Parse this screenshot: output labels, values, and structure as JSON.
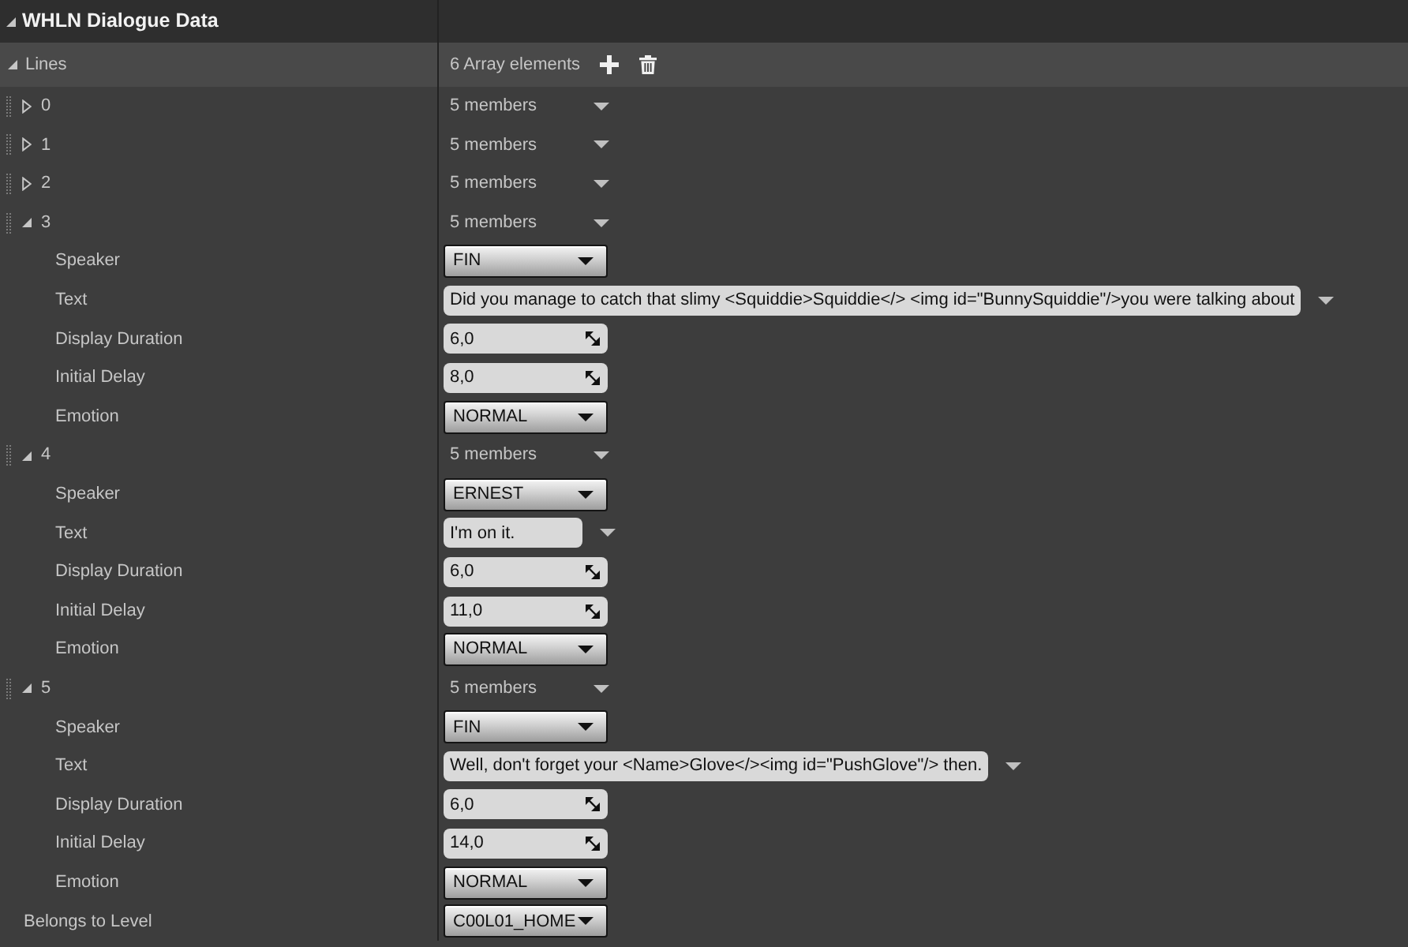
{
  "panel": {
    "title": "WHLN Dialogue Data",
    "expanded": true
  },
  "lines": {
    "label": "Lines",
    "expanded": true,
    "count": "6 Array elements",
    "elements": [
      {
        "index": "0",
        "expanded": false,
        "summary": "5 members"
      },
      {
        "index": "1",
        "expanded": false,
        "summary": "5 members"
      },
      {
        "index": "2",
        "expanded": false,
        "summary": "5 members"
      },
      {
        "index": "3",
        "expanded": true,
        "summary": "5 members",
        "members": [
          {
            "label": "Speaker",
            "kind": "dropdown",
            "value": "FIN"
          },
          {
            "label": "Text",
            "kind": "text",
            "value": "Did you manage to catch that slimy <Squiddie>Squiddie</> <img id=\"BunnySquiddie\"/>you were talking about"
          },
          {
            "label": "Display Duration",
            "kind": "number",
            "value": "6,0"
          },
          {
            "label": "Initial Delay",
            "kind": "number",
            "value": "8,0"
          },
          {
            "label": "Emotion",
            "kind": "dropdown",
            "value": "NORMAL"
          }
        ]
      },
      {
        "index": "4",
        "expanded": true,
        "summary": "5 members",
        "members": [
          {
            "label": "Speaker",
            "kind": "dropdown",
            "value": "ERNEST"
          },
          {
            "label": "Text",
            "kind": "text",
            "value": "I'm on it."
          },
          {
            "label": "Display Duration",
            "kind": "number",
            "value": "6,0"
          },
          {
            "label": "Initial Delay",
            "kind": "number",
            "value": "11,0"
          },
          {
            "label": "Emotion",
            "kind": "dropdown",
            "value": "NORMAL"
          }
        ]
      },
      {
        "index": "5",
        "expanded": true,
        "summary": "5 members",
        "members": [
          {
            "label": "Speaker",
            "kind": "dropdown",
            "value": "FIN"
          },
          {
            "label": "Text",
            "kind": "text",
            "value": "Well, don't forget your <Name>Glove</><img id=\"PushGlove\"/> then."
          },
          {
            "label": "Display Duration",
            "kind": "number",
            "value": "6,0"
          },
          {
            "label": "Initial Delay",
            "kind": "number",
            "value": "14,0"
          },
          {
            "label": "Emotion",
            "kind": "dropdown",
            "value": "NORMAL"
          }
        ]
      }
    ]
  },
  "belongs_to_level": {
    "label": "Belongs to Level",
    "kind": "dropdown",
    "value": "C00L01_HOME"
  }
}
